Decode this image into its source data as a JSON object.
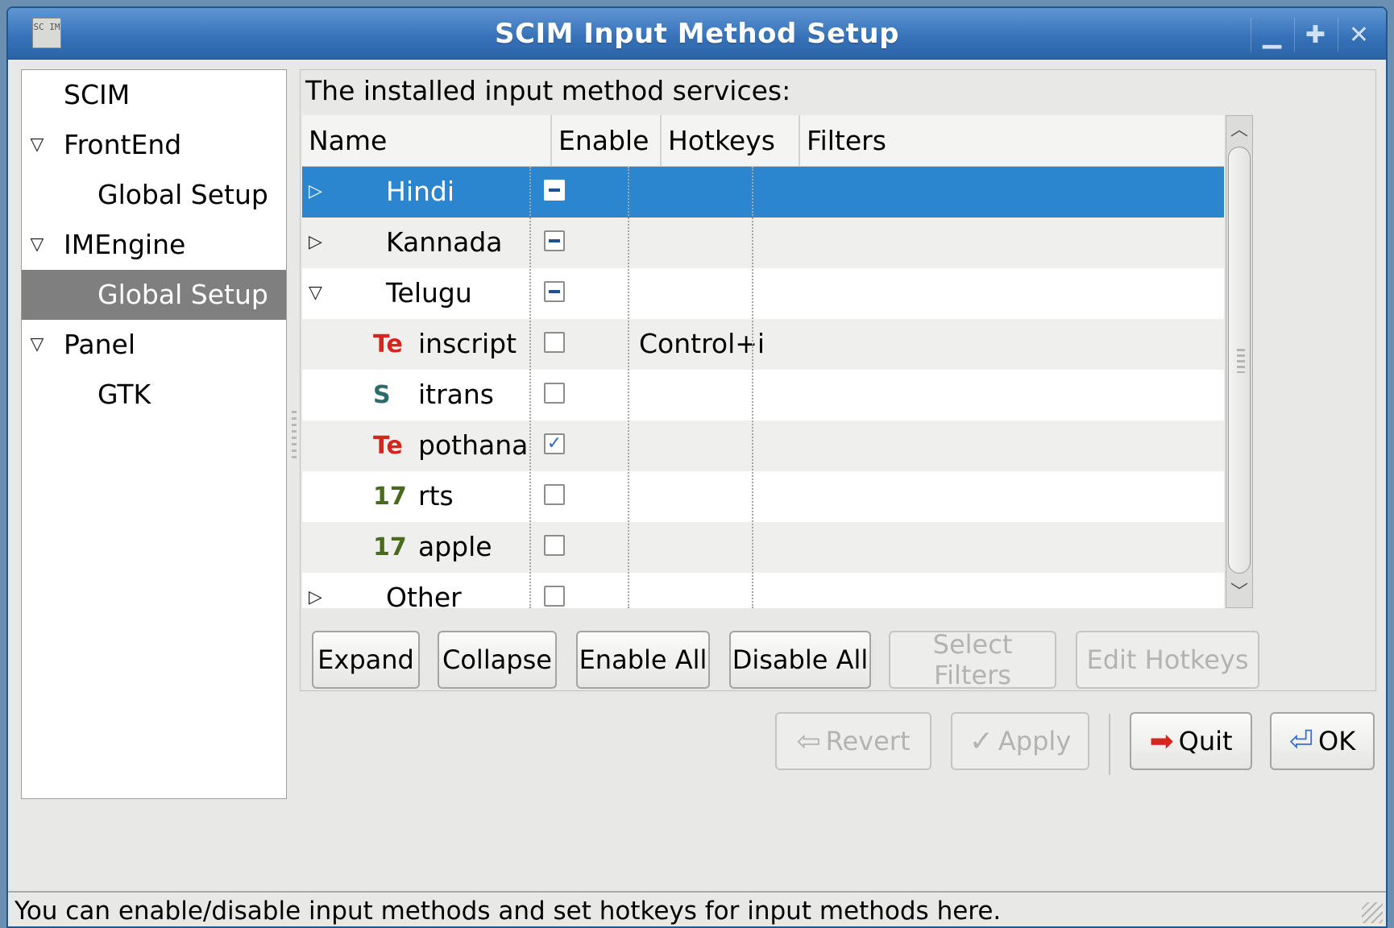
{
  "window": {
    "title": "SCIM Input Method Setup",
    "icon_text": "SC IM",
    "minimize": "▁",
    "maximize": "✚",
    "close": "✕"
  },
  "sidebar": {
    "items": [
      {
        "label": "SCIM",
        "expander": ""
      },
      {
        "label": "FrontEnd",
        "expander": "▽"
      },
      {
        "label": "Global Setup",
        "expander": ""
      },
      {
        "label": "IMEngine",
        "expander": "▽"
      },
      {
        "label": "Global Setup",
        "expander": "",
        "selected": true
      },
      {
        "label": "Panel",
        "expander": "▽"
      },
      {
        "label": "GTK",
        "expander": ""
      }
    ]
  },
  "content": {
    "caption": "The installed input method services:",
    "columns": {
      "name": "Name",
      "enable": "Enable",
      "hotkeys": "Hotkeys",
      "filters": "Filters"
    },
    "rows": [
      {
        "type": "category",
        "expander": "▷",
        "name": "Hindi",
        "enable": "mixed",
        "selected": true
      },
      {
        "type": "category",
        "expander": "▷",
        "name": "Kannada",
        "enable": "mixed"
      },
      {
        "type": "category",
        "expander": "▽",
        "name": "Telugu",
        "enable": "mixed"
      },
      {
        "type": "method",
        "icon": "te-icon",
        "icon_text": "Te",
        "name": "inscript",
        "enable": "unchecked",
        "hotkey": "Control+i"
      },
      {
        "type": "method",
        "icon": "itrans-icon",
        "icon_text": "S",
        "name": "itrans",
        "enable": "unchecked"
      },
      {
        "type": "method",
        "icon": "te-icon",
        "icon_text": "Te",
        "name": "pothana",
        "enable": "checked"
      },
      {
        "type": "method",
        "icon": "m17n-icon",
        "icon_text": "17",
        "name": "rts",
        "enable": "unchecked"
      },
      {
        "type": "method",
        "icon": "m17n-icon",
        "icon_text": "17",
        "name": "apple",
        "enable": "unchecked"
      },
      {
        "type": "category",
        "expander": "▷",
        "name": "Other",
        "enable": "unchecked"
      }
    ],
    "scroll": {
      "up": "︿",
      "down": "﹀"
    },
    "buttons": {
      "expand": "Expand",
      "collapse": "Collapse",
      "enable_all": "Enable All",
      "disable_all": "Disable All",
      "select_filters": "Select Filters",
      "edit_hotkeys": "Edit Hotkeys"
    }
  },
  "dialog": {
    "revert": "Revert",
    "apply": "Apply",
    "quit": "Quit",
    "ok": "OK",
    "revert_icon": "⇦",
    "apply_icon": "✓",
    "quit_icon": "➡",
    "ok_icon": "⏎"
  },
  "status": "You can enable/disable input methods and set hotkeys for input methods here.",
  "colors": {
    "selection": "#2b85cf",
    "titlebar": "#3571b8",
    "sidebar_selected": "#7f7f7f"
  }
}
